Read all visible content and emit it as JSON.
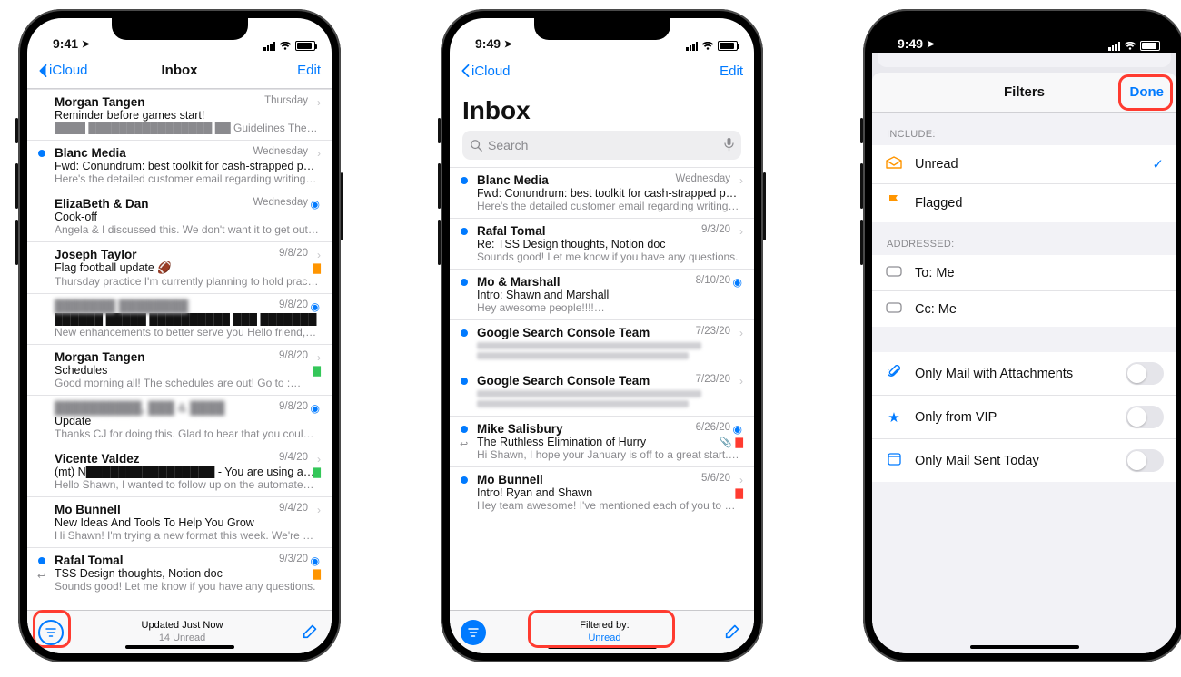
{
  "status": {
    "time_left": "9:41",
    "time_right": "9:49",
    "loc": "➤"
  },
  "nav": {
    "back": "iCloud",
    "title_small": "Inbox",
    "right": "Edit",
    "title_big": "Inbox"
  },
  "search": {
    "placeholder": "Search"
  },
  "toolbar": {
    "status_line1": "Updated Just Now",
    "status_line2": "14 Unread",
    "filtered_label": "Filtered by:",
    "filtered_value": "Unread"
  },
  "leftList": [
    {
      "sender": "Morgan Tangen",
      "date": "Thursday",
      "subject": "Reminder before games start!",
      "preview": "████ ████████████████ ██ Guidelines The f…",
      "chev": true
    },
    {
      "sender": "Blanc Media",
      "date": "Wednesday",
      "subject": "Fwd: Conundrum: best toolkit for cash-strapped people",
      "preview": "Here's the detailed customer email regarding writing tool…",
      "dot": true,
      "chev": true
    },
    {
      "sender": "ElizaBeth & Dan",
      "date": "Wednesday",
      "subject": "Cook-off",
      "preview": "Angela & I discussed this. We don't want it to get out of…",
      "bell": true
    },
    {
      "sender": "Joseph Taylor",
      "date": "9/8/20",
      "subject": "Flag football update 🏈",
      "preview": "Thursday practice I'm currently planning to hold practice…",
      "flag": "orange",
      "chev": true
    },
    {
      "sender": "███████ ████████",
      "date": "9/8/20",
      "subject": "██████ █████ ██████████ ███ ███████",
      "preview": "New enhancements to better serve you Hello friend, CH…",
      "bell": true,
      "blurName": true
    },
    {
      "sender": "Morgan Tangen",
      "date": "9/8/20",
      "subject": "Schedules",
      "preview": "Good morning all! The schedules are out! Go to :…",
      "flag": "green",
      "chev": true
    },
    {
      "sender": "██████████, ███ & ████",
      "date": "9/8/20",
      "subject": "Update",
      "preview": "Thanks CJ for doing this. Glad to hear that you could talk…",
      "bell": true,
      "blurName": true
    },
    {
      "sender": "Vicente Valdez",
      "date": "9/4/20",
      "subject": "(mt) N████████████████ - You are using a…",
      "preview": "Hello Shawn, I wanted to follow up on the automated noti…",
      "flag": "green",
      "chev": true
    },
    {
      "sender": "Mo Bunnell",
      "date": "9/4/20",
      "subject": "New Ideas And Tools To Help You Grow",
      "preview": "Hi Shawn! I'm trying a new format this week. We're crank…",
      "chev": true
    },
    {
      "sender": "Rafal Tomal",
      "date": "9/3/20",
      "subject": "TSS Design thoughts, Notion doc",
      "preview": "Sounds good! Let me know if you have any questions.",
      "dot": true,
      "flag": "orange",
      "bell": true,
      "reply": true
    }
  ],
  "midList": [
    {
      "sender": "Blanc Media",
      "date": "Wednesday",
      "subject": "Fwd: Conundrum: best toolkit for cash-strapped people",
      "preview": "Here's the detailed customer email regarding writing tool…",
      "dot": true,
      "chev": true
    },
    {
      "sender": "Rafal Tomal",
      "date": "9/3/20",
      "subject": "Re: TSS Design thoughts, Notion doc",
      "preview": "Sounds good! Let me know if you have any questions.",
      "dot": true,
      "chev": true
    },
    {
      "sender": "Mo & Marshall",
      "date": "8/10/20",
      "subject": "Intro: Shawn and Marshall",
      "preview": "Hey awesome people!!!!…",
      "dot": true,
      "bell": true
    },
    {
      "sender": "Google Search Console Team",
      "date": "7/23/20",
      "subject": "blurred",
      "preview": "blurred",
      "dot": true,
      "chev": true,
      "blurBody": true
    },
    {
      "sender": "Google Search Console Team",
      "date": "7/23/20",
      "subject": "blurred",
      "preview": "blurred",
      "dot": true,
      "chev": true,
      "blurBody": true
    },
    {
      "sender": "Mike Salisbury",
      "date": "6/26/20",
      "subject": "The Ruthless Elimination of Hurry",
      "preview": "Hi Shawn, I hope your January is off to a great start. I've…",
      "dot": true,
      "bell": true,
      "flag": "red",
      "reply": true,
      "clip": true
    },
    {
      "sender": "Mo Bunnell",
      "date": "5/6/20",
      "subject": "Intro! Ryan and Shawn",
      "preview": "Hey team awesome! I've mentioned each of you to each…",
      "dot": true,
      "chev": true,
      "flag": "red"
    }
  ],
  "filters": {
    "title": "Filters",
    "done": "Done",
    "sec_include": "INCLUDE:",
    "sec_addressed": "ADDRESSED:",
    "unread": "Unread",
    "flagged": "Flagged",
    "tome": "To: Me",
    "ccme": "Cc: Me",
    "attach": "Only Mail with Attachments",
    "vip": "Only from VIP",
    "today": "Only Mail Sent Today"
  },
  "colors": {
    "blue": "#007aff",
    "red": "#ff3b30",
    "orange": "#ff9500"
  }
}
